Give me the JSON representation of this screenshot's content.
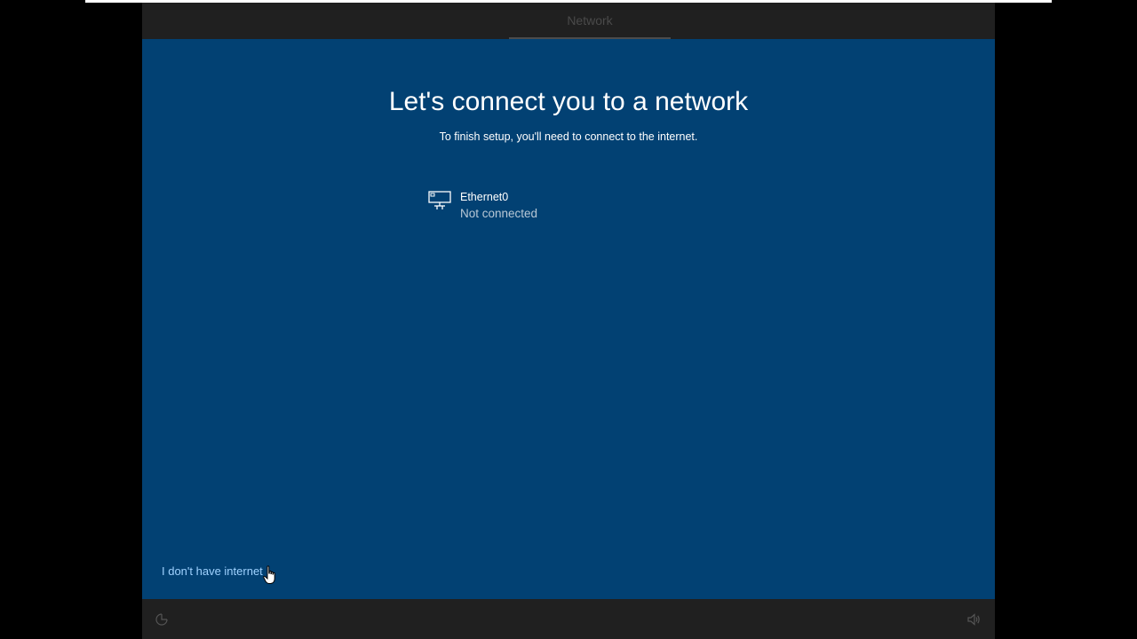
{
  "topbar": {
    "step_label": "Network"
  },
  "main": {
    "title": "Let's connect you to a network",
    "subtitle": "To finish setup, you'll need to connect to the internet.",
    "networks": [
      {
        "name": "Ethernet0",
        "status": "Not connected",
        "icon": "ethernet-icon"
      }
    ],
    "no_internet_link": "I don't have internet"
  },
  "bottombar": {
    "left_icon": "ease-of-access-icon",
    "right_icon": "volume-icon"
  },
  "colors": {
    "background_blue": "#024173",
    "bar_dark": "#202020",
    "link_blue": "#9fd2ff",
    "status_text": "#b9c8d6"
  }
}
